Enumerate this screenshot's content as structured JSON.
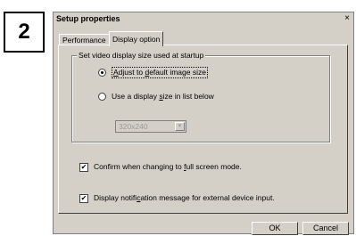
{
  "step_number": "2",
  "dialog": {
    "title": "Setup properties",
    "close_glyph": "×"
  },
  "tabs": [
    {
      "label": "Performance"
    },
    {
      "label": "Display option"
    }
  ],
  "group": {
    "title": "Set video display size used at startup",
    "radio_default": {
      "pre": "",
      "acc": "A",
      "post": "djust to ",
      "acc2": "d",
      "post2": "efault image size",
      "checked": true
    },
    "radio_list": {
      "pre": "Use a display ",
      "acc": "s",
      "post": "ize in list below",
      "checked": false
    },
    "size_select": {
      "value": "320x240",
      "arrow": "▼"
    }
  },
  "checks": {
    "fullscreen": {
      "pre": "Confirm when changing to ",
      "acc": "f",
      "post": "ull screen mode.",
      "checked": true
    },
    "notification": {
      "pre": "Display notifi",
      "acc": "c",
      "post": "ation message for external device input.",
      "checked": true
    }
  },
  "buttons": {
    "ok": "OK",
    "cancel": "Cancel"
  }
}
